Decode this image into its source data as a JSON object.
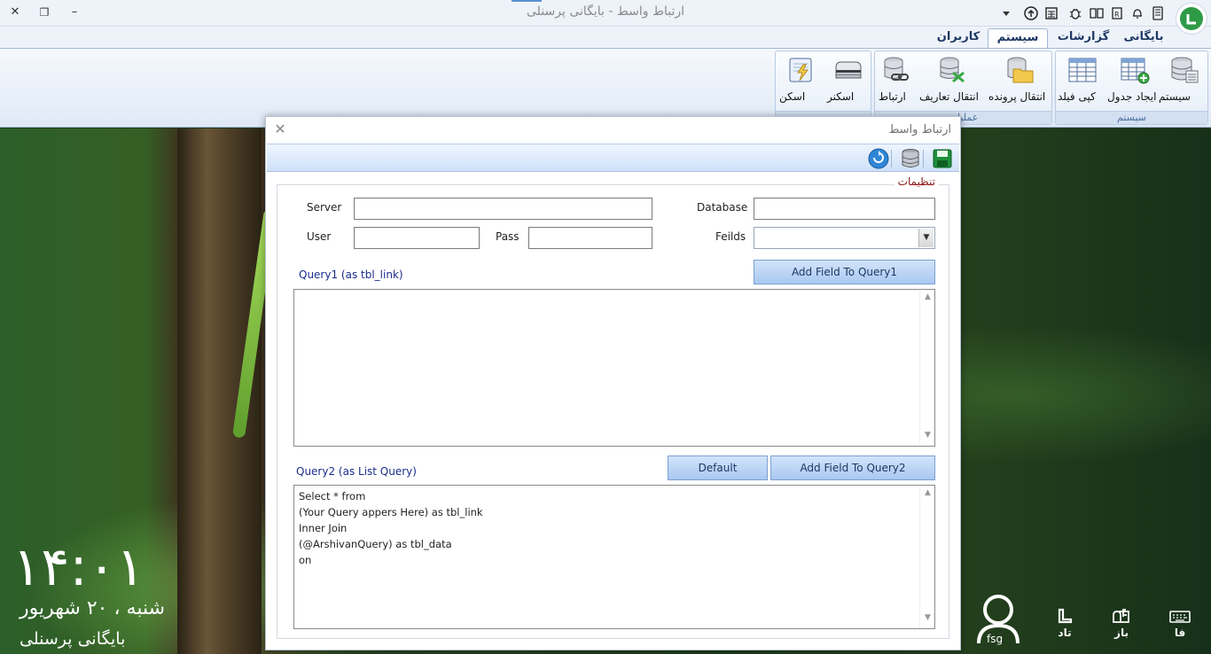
{
  "window": {
    "title": "ارتباط واسط - بایگانی پرسنلی",
    "close": "✕",
    "restore": "❐",
    "minimize": "–"
  },
  "quick_access": [
    "dropdown-arrow-icon",
    "upload-icon",
    "calculator-icon",
    "bug-icon",
    "book-icon",
    "document-icon",
    "bell-icon",
    "mobile-icon"
  ],
  "tabs": [
    {
      "label": "بایگانی",
      "active": false
    },
    {
      "label": "گزارشات",
      "active": false
    },
    {
      "label": "سیستم",
      "active": true
    },
    {
      "label": "کاربران",
      "active": false
    }
  ],
  "ribbon": {
    "groups": {
      "system": "سیستم",
      "operations": "عملیات"
    },
    "buttons": {
      "system": "سیستم",
      "create_table": "ایجاد جدول",
      "copy_field": "کپی فیلد",
      "transfer_file": "انتقال پرونده",
      "transfer_definitions": "انتقال تعاریف",
      "connection": "ارتباط",
      "scanner": "اسکنر",
      "scan": "اسکن"
    }
  },
  "dialog": {
    "title": "ارتباط واسط",
    "close": "✕",
    "panel_caption": "تنظیمات",
    "labels": {
      "server": "Server",
      "database": "Database",
      "user": "User",
      "pass": "Pass",
      "feilds": "Feilds",
      "query1": "Query1 (as tbl_link)",
      "query2": "Query2 (as List Query)"
    },
    "values": {
      "server": "",
      "database": "",
      "user": "",
      "pass": "",
      "feilds": "",
      "query1": ""
    },
    "buttons": {
      "add_field_query1": "Add Field To Query1",
      "default": "Default",
      "add_field_query2": "Add Field To Query2"
    },
    "query2_lines": [
      "Select * from",
      "(Your Query appers Here) as tbl_link",
      "Inner Join",
      "(@ArshivanQuery) as tbl_data",
      "on"
    ]
  },
  "desktop": {
    "time": "۱۴:۰۱",
    "date": "شنبه ، ۲۰ شهریور",
    "app_name": "بایگانی پرسنلی",
    "user": "fsg",
    "tray": [
      {
        "label": "تاد",
        "icon": "phone-icon"
      },
      {
        "label": "باز",
        "icon": "mailbox-icon"
      },
      {
        "label": "فا",
        "icon": "keyboard-icon"
      }
    ]
  },
  "colors": {
    "accent": "#1f3864",
    "section_caption": "#8b0e0e",
    "button_blue": "#a9c8f0"
  }
}
